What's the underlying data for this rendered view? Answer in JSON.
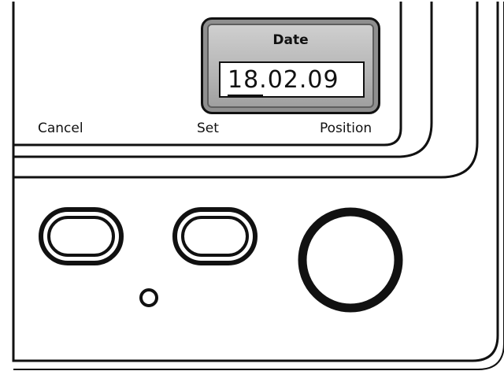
{
  "display": {
    "title": "Date",
    "value": "18.02.09"
  },
  "softkeys": {
    "cancel": "Cancel",
    "set": "Set",
    "position": "Position"
  },
  "colors": {
    "outline": "#111111",
    "lcd_bezel": "#b4b4b4",
    "lcd_field": "#ffffff",
    "background": "#ffffff"
  },
  "icons": {
    "cancel_key": "oval-button",
    "set_key": "oval-button",
    "position_key": "round-knob",
    "indicator": "small-ring-led"
  }
}
